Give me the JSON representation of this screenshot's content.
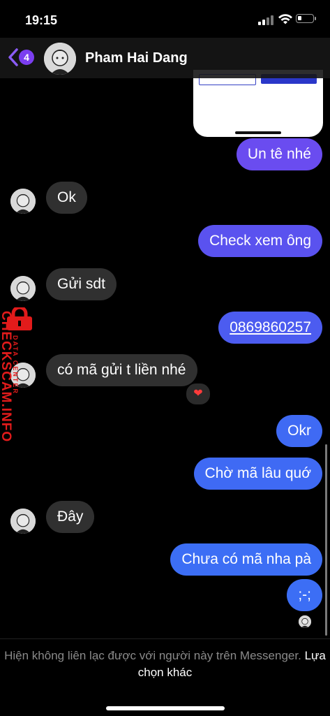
{
  "status": {
    "time": "19:15"
  },
  "header": {
    "unread_count": "4",
    "contact_name": "Pham Hai Dang"
  },
  "messages": [
    {
      "side": "out",
      "text": "Un tê nhé"
    },
    {
      "side": "in",
      "text": "Ok"
    },
    {
      "side": "out",
      "text": "Check xem ông"
    },
    {
      "side": "in",
      "text": "Gửi sdt"
    },
    {
      "side": "out",
      "text": "0869860257"
    },
    {
      "side": "in",
      "text": "có mã gửi t liền nhé",
      "reaction": "❤"
    },
    {
      "side": "out",
      "text": "Okr"
    },
    {
      "side": "out",
      "text": "Chờ mã lâu quớ"
    },
    {
      "side": "in",
      "text": "Đây"
    },
    {
      "side": "out",
      "text": "Chưa có mã nha pà"
    },
    {
      "side": "out",
      "text": ";-;"
    }
  ],
  "watermark": {
    "brand": "CHECKSCAM.INFO",
    "tagline": "DATA CENTER"
  },
  "footer": {
    "notice": "Hiện không liên lạc được với người này trên Messenger.",
    "link": "Lựa chọn khác"
  },
  "colors": {
    "bubble_in": "#303030",
    "bubble_out_top": "#6a4cf0",
    "bubble_out_bottom": "#3c6ef5",
    "badge": "#7b3ef0",
    "watermark": "#e21b1b"
  }
}
